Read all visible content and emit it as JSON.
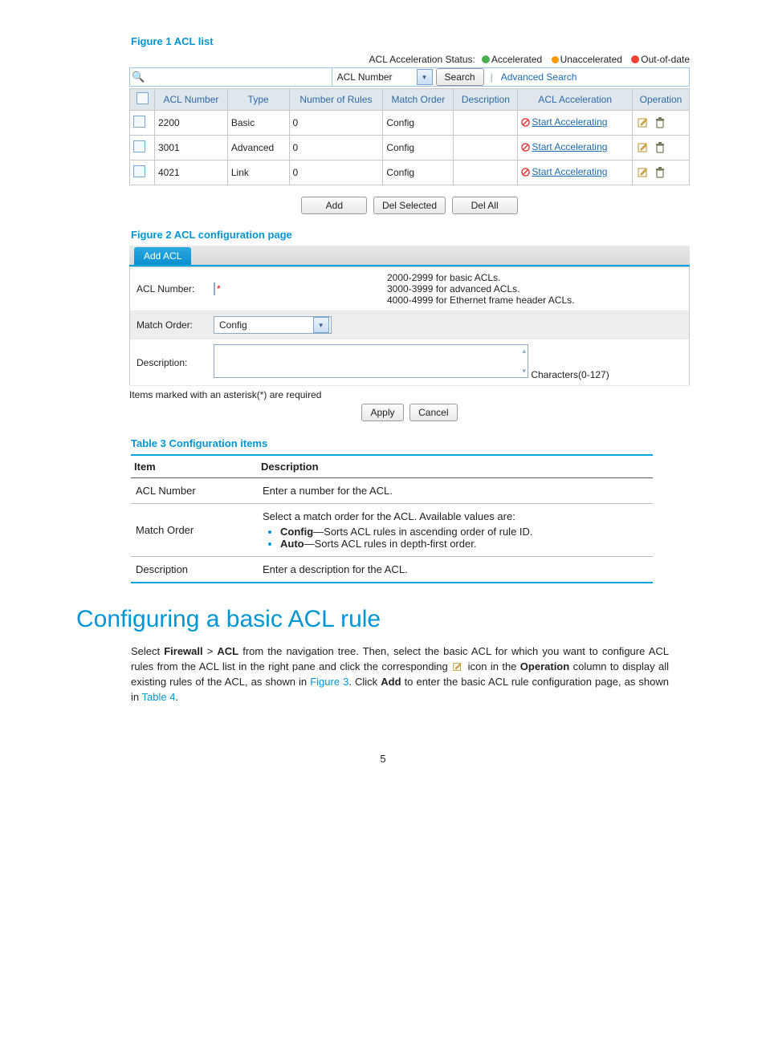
{
  "figure1": {
    "caption": "Figure 1 ACL list",
    "status_label": "ACL Acceleration Status:",
    "statuses": [
      "Accelerated",
      "Unaccelerated",
      "Out-of-date"
    ],
    "search_combo": "ACL Number",
    "search_btn": "Search",
    "adv_search": "Advanced Search",
    "headers": [
      "ACL Number",
      "Type",
      "Number of Rules",
      "Match Order",
      "Description",
      "ACL Acceleration",
      "Operation"
    ],
    "rows": [
      {
        "num": "2200",
        "type": "Basic",
        "rules": "0",
        "match": "Config",
        "desc": "",
        "acc": "Start Accelerating"
      },
      {
        "num": "3001",
        "type": "Advanced",
        "rules": "0",
        "match": "Config",
        "desc": "",
        "acc": "Start Accelerating"
      },
      {
        "num": "4021",
        "type": "Link",
        "rules": "0",
        "match": "Config",
        "desc": "",
        "acc": "Start Accelerating"
      }
    ],
    "buttons": [
      "Add",
      "Del Selected",
      "Del All"
    ]
  },
  "figure2": {
    "caption": "Figure 2 ACL configuration page",
    "tab": "Add ACL",
    "acl_number_label": "ACL Number:",
    "help_lines": [
      "2000-2999 for basic ACLs.",
      "3000-3999 for advanced ACLs.",
      "4000-4999 for Ethernet frame header ACLs."
    ],
    "match_label": "Match Order:",
    "match_val": "Config",
    "desc_label": "Description:",
    "chars": "Characters(0-127)",
    "note": "Items marked with an asterisk(*) are required",
    "apply": "Apply",
    "cancel": "Cancel"
  },
  "table3": {
    "caption": "Table 3 Configuration items",
    "head_item": "Item",
    "head_desc": "Description",
    "rows": [
      {
        "item": "ACL Number",
        "desc": "Enter a number for the ACL."
      },
      {
        "item": "Match Order",
        "desc": "Select a match order for the ACL. Available values are:",
        "b1a": "Config",
        "b1b": "—Sorts ACL rules in ascending order of rule ID.",
        "b2a": "Auto",
        "b2b": "—Sorts ACL rules in depth-first order."
      },
      {
        "item": "Description",
        "desc": "Enter a description for the ACL."
      }
    ]
  },
  "section": {
    "title": "Configuring a basic ACL rule",
    "p1a": "Select ",
    "p1b": "Firewall",
    "p1c": " > ",
    "p1d": "ACL",
    "p1e": " from the navigation tree. Then, select the basic ACL for which you want to configure ACL rules from the ACL list in the right pane and click the corresponding ",
    "p1f": " icon in the ",
    "p1g": "Operation",
    "p1h": " column to display all existing rules of the ACL, as shown in ",
    "p1i": "Figure 3",
    "p1j": ". Click ",
    "p1k": "Add",
    "p1l": " to enter the basic ACL rule configuration page, as shown in ",
    "p1m": "Table 4",
    "p1n": "."
  },
  "page_number": "5"
}
